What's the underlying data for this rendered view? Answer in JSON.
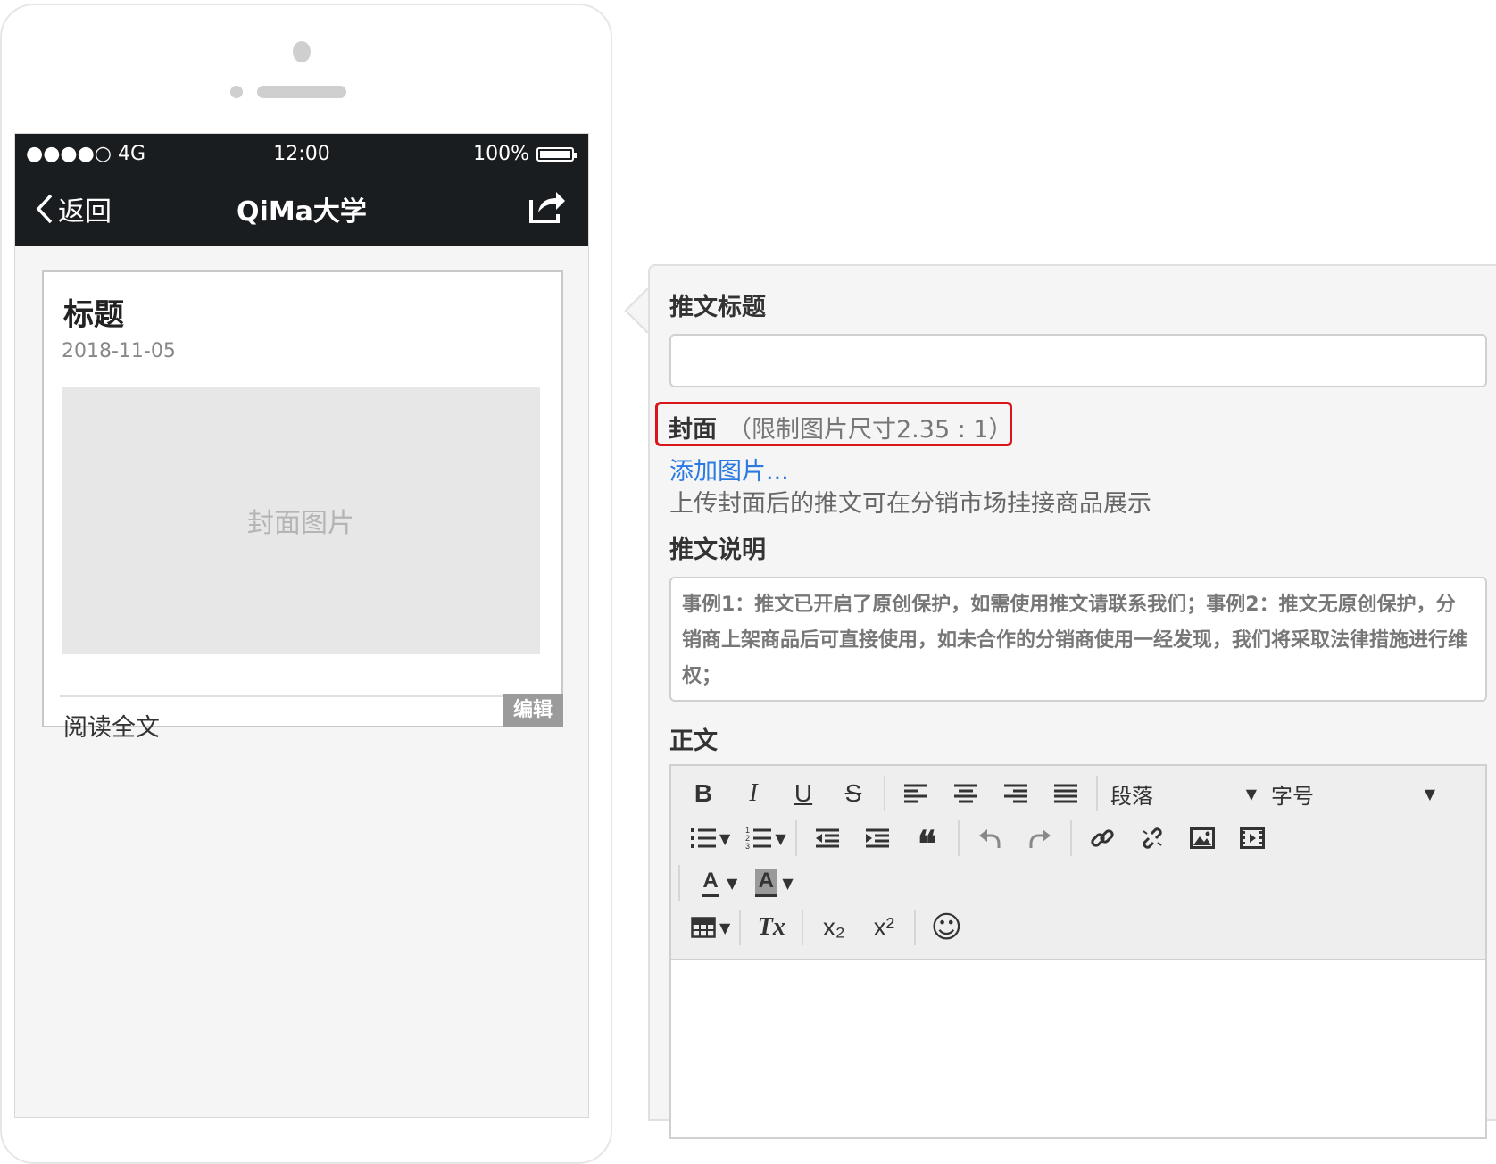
{
  "phone": {
    "status": {
      "signal": "●●●●○ 4G",
      "time": "12:00",
      "battery": "100%"
    },
    "nav": {
      "back_label": "返回",
      "title": "QiMa大学"
    },
    "card": {
      "title": "标题",
      "date": "2018-11-05",
      "cover_placeholder": "封面图片",
      "read_more": "阅读全文",
      "arrow": ">",
      "edit_badge": "编辑"
    }
  },
  "form": {
    "title_label": "推文标题",
    "title_value": "",
    "cover_label": "封面",
    "cover_hint": "（限制图片尺寸2.35 : 1）",
    "add_image": "添加图片...",
    "upload_tip": "上传封面后的推文可在分销市场挂接商品展示",
    "desc_label": "推文说明",
    "desc_text": "事例1：推文已开启了原创保护，如需使用推文请联系我们；事例2：推文无原创保护，分销商上架商品后可直接使用，如未合作的分销商使用一经发现，我们将采取法律措施进行维权；",
    "body_label": "正文",
    "toolbar": {
      "bold": "B",
      "italic": "I",
      "underline": "U",
      "strike": "S",
      "paragraph_select": "段落",
      "fontsize_select": "字号",
      "quote": "❝",
      "font_color": "A",
      "bg_color": "A",
      "clear_format": "Tx",
      "subscript": "x₂",
      "superscript": "x²",
      "emoji": "☺"
    }
  },
  "colors": {
    "highlight_border": "#d9161c",
    "link": "#2a7ae2",
    "nav_bg": "#1a1d20"
  }
}
